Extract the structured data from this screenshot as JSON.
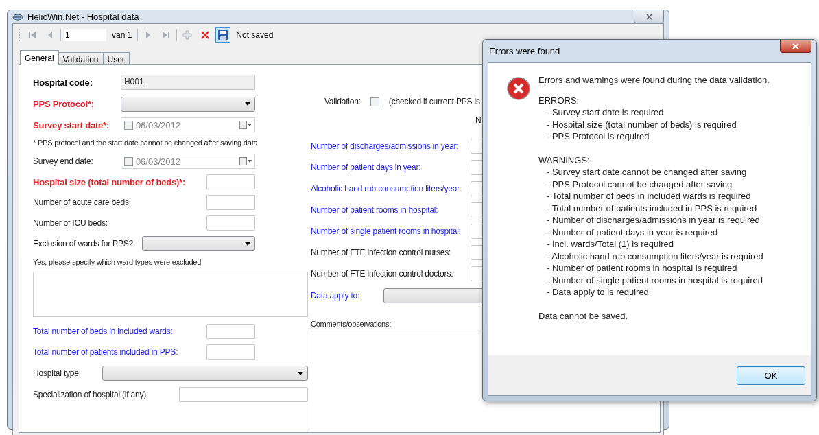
{
  "window": {
    "title": "HelicWin.Net - Hospital data"
  },
  "toolbar": {
    "buttons": [
      {
        "kind": "first",
        "disabled": true
      },
      {
        "kind": "prev",
        "disabled": true
      }
    ],
    "record": "1",
    "of_label": "van 1",
    "buttons_after": [
      {
        "kind": "next",
        "disabled": true
      },
      {
        "kind": "last",
        "disabled": true
      },
      {
        "kind": "add",
        "disabled": true
      },
      {
        "kind": "delete",
        "disabled": false
      },
      {
        "kind": "save",
        "disabled": false
      }
    ],
    "status": "Not saved"
  },
  "tabs": [
    {
      "label": "General",
      "selected": true
    },
    {
      "label": "Validation",
      "selected": false
    },
    {
      "label": "User",
      "selected": false
    }
  ],
  "left_form": [
    {
      "kind": "text",
      "label": "Hospital code:",
      "bold": true,
      "color": "#000000",
      "value": "H001"
    },
    {
      "kind": "select",
      "label": "PPS Protocol*:",
      "bold": true,
      "color": "#e0202a"
    },
    {
      "kind": "date",
      "label": "Survey start date*:",
      "bold": true,
      "color": "#e0202a",
      "value": "06/03/2012",
      "checked": false
    },
    {
      "kind": "note",
      "label": "* PPS protocol and the start date cannot be changed after saving data"
    },
    {
      "kind": "date",
      "label": "Survey end date:",
      "bold": false,
      "color": "#222222",
      "value": "06/03/2012",
      "checked": false
    },
    {
      "kind": "number",
      "label": "Hospital size (total number of beds)*:",
      "bold": true,
      "color": "#e0202a"
    },
    {
      "kind": "number",
      "label": "Number of acute care beds:",
      "bold": false,
      "color": "#222222"
    },
    {
      "kind": "number",
      "label": "Number of ICU beds:",
      "bold": false,
      "color": "#222222"
    },
    {
      "kind": "combo",
      "label": "Exclusion of wards for PPS?",
      "bold": false,
      "color": "#222222"
    },
    {
      "kind": "note",
      "label": "Yes, please specify which ward types were excluded"
    },
    {
      "kind": "memo"
    },
    {
      "kind": "number",
      "label": "Total number of beds in included wards:",
      "bold": false,
      "color": "#2424e0"
    },
    {
      "kind": "number",
      "label": "Total number of patients included in PPS:",
      "bold": false,
      "color": "#2424e0"
    },
    {
      "kind": "dropdown",
      "label": "Hospital type:",
      "bold": false,
      "color": "#222222"
    },
    {
      "kind": "input",
      "label": "Specialization of hospital (if any):",
      "bold": false,
      "color": "#222222"
    }
  ],
  "validation": {
    "label": "Validation:",
    "checked": false,
    "note": "(checked if current PPS is",
    "column_2": "N"
  },
  "middle_form": [
    {
      "kind": "number",
      "label": "Number of discharges/admissions in year:",
      "bold": false,
      "color": "#2424e0"
    },
    {
      "kind": "number",
      "label": "Number of patient days in year:",
      "bold": false,
      "color": "#2424e0"
    },
    {
      "kind": "number",
      "label": "Alcoholic hand rub consumption liters/year:",
      "bold": false,
      "color": "#2424e0"
    },
    {
      "kind": "number",
      "label": "Number of patient rooms in hospital:",
      "bold": false,
      "color": "#2424e0"
    },
    {
      "kind": "number",
      "label": "Number of single patient rooms in hospital:",
      "bold": false,
      "color": "#2424e0"
    },
    {
      "kind": "number",
      "label": "Number of FTE infection control nurses:",
      "bold": false,
      "color": "#222222"
    },
    {
      "kind": "number",
      "label": "Number of FTE infection control doctors:",
      "bold": false,
      "color": "#222222"
    },
    {
      "kind": "dropdown",
      "label": "Data apply to:",
      "bold": false,
      "color": "#2424e0"
    },
    {
      "kind": "note",
      "label": "Comments/observations:"
    },
    {
      "kind": "memo"
    }
  ],
  "dialog": {
    "title": "Errors were found",
    "message": "Errors and warnings were found during the data validation.",
    "errors_heading": "ERRORS:",
    "errors": [
      "- Survey start date is required",
      "- Hospital size (total number of beds) is required",
      "- PPS Protocol is required"
    ],
    "warnings_heading": "WARNINGS:",
    "warnings": [
      "- Survey start date cannot be changed after saving",
      "- PPS Protocol cannot be changed after saving",
      "- Total number of beds in included wards is required",
      "- Total number of patients included in PPS is required",
      "- Number of discharges/admissions in year is required",
      "- Number of patient days in year is required",
      "- Incl. wards/Total (1) is required",
      "- Alcoholic hand rub consumption liters/year is required",
      "- Number of patient rooms in hospital is required",
      "- Number of single patient rooms in hospital is required",
      "- Data apply to is required"
    ],
    "footer": "Data cannot be saved.",
    "button": "OK"
  }
}
